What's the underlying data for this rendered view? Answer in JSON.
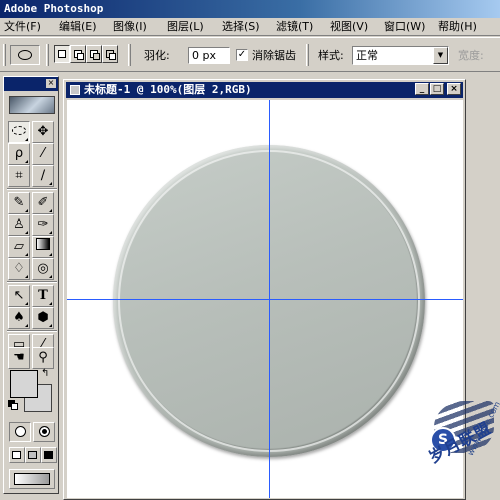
{
  "app": {
    "title": "Adobe Photoshop"
  },
  "menu": {
    "items": [
      "文件(F)",
      "编辑(E)",
      "图像(I)",
      "图层(L)",
      "选择(S)",
      "滤镜(T)",
      "视图(V)",
      "窗口(W)",
      "帮助(H)"
    ]
  },
  "options": {
    "feather_label": "羽化:",
    "feather_value": "0 px",
    "antialias_checked": true,
    "antialias_label": "消除锯齿",
    "style_label": "样式:",
    "style_value": "正常",
    "width_label": "宽度:"
  },
  "document": {
    "title": "未标题-1 @ 100%(图层 2,RGB)",
    "canvas_color": "#ffffff",
    "disk_color": "#b8bfba",
    "guide_color": "#2a5cff"
  },
  "toolbox": {
    "tools": [
      "elliptical-marquee",
      "move",
      "lasso",
      "magic-wand",
      "crop",
      "slice",
      "healing-brush",
      "brush",
      "clone-stamp",
      "history-brush",
      "eraser",
      "gradient",
      "blur",
      "dodge",
      "path-selection",
      "type",
      "pen",
      "custom-shape",
      "notes",
      "eyedropper",
      "hand",
      "zoom"
    ],
    "type_glyph": "T",
    "foreground_color": "#d6d6d6",
    "background_color": "#d6d6d6"
  },
  "watermark": {
    "text": "岁月联盟",
    "badge": "S",
    "url": "www.syue.com"
  }
}
